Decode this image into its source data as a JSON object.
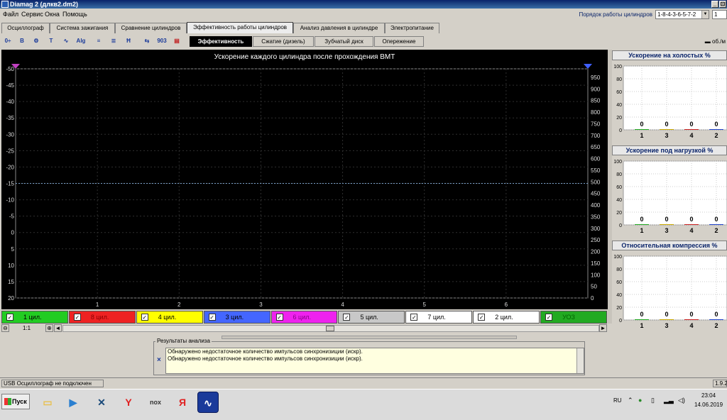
{
  "window": {
    "title": "Diamag 2 (длкв2.dm2)",
    "minimize": "_",
    "maximize": "⊡"
  },
  "menu": {
    "items": [
      "Файл",
      "Сервис",
      "Окна",
      "Помощь"
    ],
    "firing_order_label": "Порядок работы цилиндров",
    "firing_order_value": "1-8-4-3-6-5-7-2",
    "count_value": "1"
  },
  "tabs": [
    "Осциллограф",
    "Система зажигания",
    "Сравнение цилиндров",
    "Эффективность работы цилиндров",
    "Анализ давления в цилиндре",
    "Электропитание"
  ],
  "active_tab": 3,
  "toolbar": {
    "icons": [
      "0÷",
      "B",
      "⚙",
      "Т",
      "∿",
      "Alg",
      "≡",
      "≣",
      "Ħ",
      "⇆",
      "903",
      "▤"
    ],
    "subtabs": [
      "Эффективность",
      "Сжатие (дизель)",
      "Зубчатый диск",
      "Опережение"
    ],
    "active_subtab": 0,
    "units": "▬ об./м"
  },
  "chart_data": {
    "type": "line",
    "title": "Ускорение каждого цилиндра после прохождения ВМТ",
    "left_axis": {
      "ticks": [
        "-50",
        "-45",
        "-40",
        "-35",
        "-30",
        "-25",
        "-20",
        "-15",
        "-10",
        "-5",
        "0",
        "5",
        "10",
        "15",
        "20"
      ],
      "range": [
        -50,
        20
      ]
    },
    "right_axis": {
      "ticks": [
        "950",
        "900",
        "850",
        "800",
        "750",
        "700",
        "650",
        "600",
        "550",
        "500",
        "450",
        "400",
        "350",
        "300",
        "250",
        "200",
        "150",
        "100",
        "50",
        "0"
      ],
      "range": [
        0,
        950
      ]
    },
    "x_ticks": [
      "1",
      "2",
      "3",
      "4",
      "5",
      "6"
    ],
    "reference_line_left_value": -15,
    "background": "#000000",
    "grid": true
  },
  "cylinders": [
    {
      "label": "1 цил.",
      "color": "#22cc22",
      "text": "#000000"
    },
    {
      "label": "8 цил.",
      "color": "#ee2222",
      "text": "#880000"
    },
    {
      "label": "4 цил.",
      "color": "#ffff00",
      "text": "#000000"
    },
    {
      "label": "3 цил.",
      "color": "#4466ff",
      "text": "#000000"
    },
    {
      "label": "6 цил.",
      "color": "#ee22ee",
      "text": "#880088"
    },
    {
      "label": "5 цил.",
      "color": "#c8c8c8",
      "text": "#000000"
    },
    {
      "label": "7 цил.",
      "color": "#ffffff",
      "text": "#000000"
    },
    {
      "label": "2 цил.",
      "color": "#ffffff",
      "text": "#000000"
    },
    {
      "label": "УОЗ",
      "color": "#22aa22",
      "text": "#006600"
    }
  ],
  "zoom": {
    "minus": "⊖",
    "value": "1:1",
    "plus": "⊕",
    "left": "◄",
    "right": "►"
  },
  "results": {
    "title": "Результаты анализа",
    "close": "×",
    "lines": [
      "Обнаружено недостаточное количество импульсов синхронизиции (искр).",
      "Обнаружено недостаточное количество импульсов синхронизиции (искр)."
    ]
  },
  "panels": [
    {
      "title": "Ускорение на холостых %",
      "bars": [
        {
          "x": "1",
          "v": "0"
        },
        {
          "x": "3",
          "v": "0"
        },
        {
          "x": "4",
          "v": "0"
        },
        {
          "x": "2",
          "v": "0"
        }
      ],
      "yticks": [
        "100",
        "80",
        "60",
        "40",
        "20",
        "0"
      ]
    },
    {
      "title": "Ускорение под нагрузкой %",
      "bars": [
        {
          "x": "1",
          "v": "0"
        },
        {
          "x": "3",
          "v": "0"
        },
        {
          "x": "4",
          "v": "0"
        },
        {
          "x": "2",
          "v": "0"
        }
      ],
      "yticks": [
        "100",
        "80",
        "60",
        "40",
        "20",
        "0"
      ]
    },
    {
      "title": "Относительная компрессия %",
      "bars": [
        {
          "x": "1",
          "v": "0"
        },
        {
          "x": "3",
          "v": "0"
        },
        {
          "x": "4",
          "v": "0"
        },
        {
          "x": "2",
          "v": "0"
        }
      ],
      "yticks": [
        "100",
        "80",
        "60",
        "40",
        "20",
        "0"
      ]
    }
  ],
  "status": {
    "left": "USB Осциллограф не подключен",
    "right": "1.9.2"
  },
  "taskbar": {
    "start": "Пуск",
    "apps": [
      {
        "name": "folder-icon",
        "glyph": "▭",
        "color": "#e8c050"
      },
      {
        "name": "media-player-icon",
        "glyph": "▶",
        "color": "#2a7fd0"
      },
      {
        "name": "x-app-icon",
        "glyph": "✕",
        "color": "#1a4a7a"
      },
      {
        "name": "yandex-browser-icon",
        "glyph": "Y",
        "color": "#e02020"
      },
      {
        "name": "nox-icon",
        "glyph": "nox",
        "color": "#333333"
      },
      {
        "name": "yandex-icon",
        "glyph": "Я",
        "color": "#e02020"
      },
      {
        "name": "diamag-icon",
        "glyph": "∿",
        "color": "#1a3a9a"
      }
    ],
    "lang": "RU",
    "time": "23:04",
    "date": "14.06.2019"
  }
}
